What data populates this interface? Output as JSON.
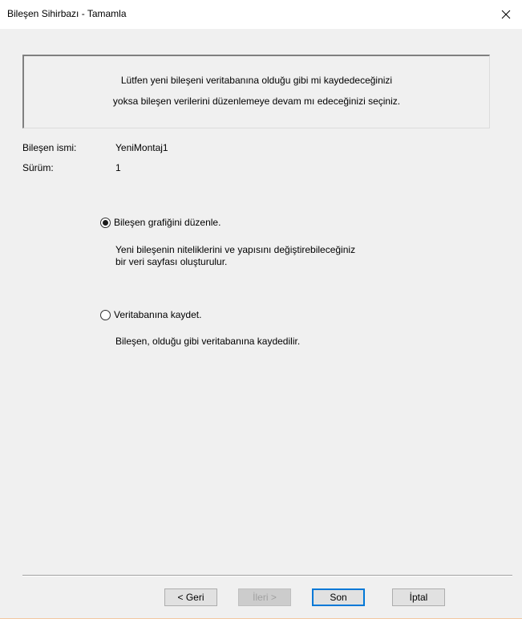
{
  "window": {
    "title": "Bileşen Sihirbazı  - Tamamla",
    "close_glyph": "×"
  },
  "info": {
    "line1": "Lütfen yeni bileşeni veritabanına olduğu gibi mi kaydedeceğinizi",
    "line2": "yoksa bileşen verilerini düzenlemeye devam mı edeceğinizi seçiniz."
  },
  "fields": {
    "name_label": "Bileşen ismi:",
    "name_value": "YeniMontaj1",
    "version_label": "Sürüm:",
    "version_value": "1"
  },
  "options": [
    {
      "label": "Bileşen grafiğini düzenle.",
      "selected": true,
      "desc_line1": "Yeni bileşenin niteliklerini ve yapısını değiştirebileceğiniz",
      "desc_line2": "bir veri sayfası oluşturulur."
    },
    {
      "label": "Veritabanına kaydet.",
      "selected": false,
      "desc_line1": "Bileşen, olduğu gibi veritabanına kaydedilir."
    }
  ],
  "buttons": {
    "back": "< Geri",
    "next": "İleri >",
    "finish": "Son",
    "cancel": "İptal"
  }
}
